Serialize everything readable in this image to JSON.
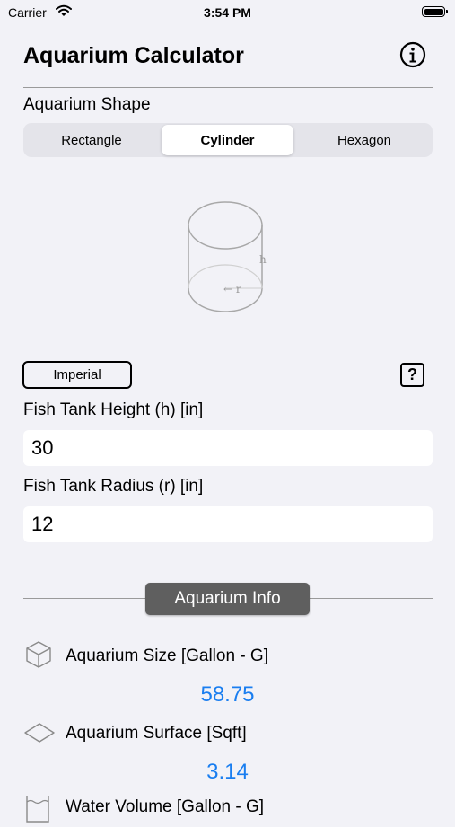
{
  "status_bar": {
    "carrier": "Carrier",
    "time": "3:54 PM"
  },
  "header": {
    "title": "Aquarium Calculator"
  },
  "shape_section": {
    "label": "Aquarium Shape",
    "segments": [
      "Rectangle",
      "Cylinder",
      "Hexagon"
    ],
    "selected": "Cylinder"
  },
  "diagram": {
    "height_label": "h",
    "radius_label": "← r"
  },
  "units": {
    "toggle_label": "Imperial",
    "help_label": "?"
  },
  "inputs": {
    "height": {
      "label": "Fish Tank Height (h) [in]",
      "value": "30"
    },
    "radius": {
      "label": "Fish Tank Radius (r) [in]",
      "value": "12"
    }
  },
  "info": {
    "section_title": "Aquarium Info",
    "metrics": [
      {
        "label": "Aquarium Size [Gallon - G]",
        "value": "58.75",
        "icon": "cube-icon"
      },
      {
        "label": "Aquarium Surface [Sqft]",
        "value": "3.14",
        "icon": "surface-icon"
      },
      {
        "label": "Water Volume [Gallon - G]",
        "value": "",
        "icon": "water-volume-icon"
      }
    ]
  },
  "colors": {
    "accent_value": "#1a7ef0",
    "background": "#f2f2f7",
    "pill_background": "#5f5f5f"
  }
}
